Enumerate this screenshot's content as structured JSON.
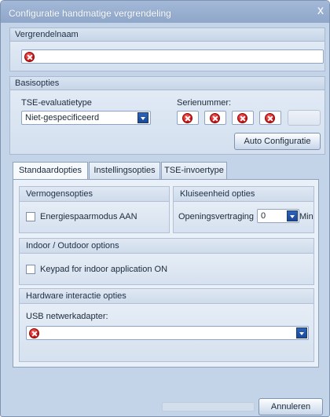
{
  "window": {
    "title": "Configuratie handmatige vergrendeling",
    "close_glyph": "x"
  },
  "lock_name": {
    "header": "Vergrendelnaam",
    "value": ""
  },
  "basic_options": {
    "header": "Basisopties",
    "tse_type_label": "TSE-evaluatietype",
    "tse_type_value": "Niet-gespecificeerd",
    "serial_label": "Serienummer:",
    "serial_fields": [
      "",
      "",
      "",
      ""
    ],
    "auto_config_label": "Auto Configuratie"
  },
  "tabs": [
    {
      "label": "Standaardopties",
      "active": true
    },
    {
      "label": "Instellingsopties",
      "active": false
    },
    {
      "label": "TSE-invoertype",
      "active": false
    }
  ],
  "standard_options": {
    "power_header": "Vermogensopties",
    "power_checkbox_label": "Energiespaarmodus AAN",
    "power_checked": false,
    "safe_header": "Kluiseenheid opties",
    "opening_delay_label": "Openingsvertraging",
    "opening_delay_value": "0",
    "opening_delay_unit": "Min",
    "indoor_header": "Indoor / Outdoor options",
    "keypad_label": "Keypad for indoor application ON",
    "keypad_checked": false,
    "hardware_header": "Hardware interactie opties",
    "usb_label": "USB netwerkadapter:",
    "usb_value": ""
  },
  "footer": {
    "cancel_label": "Annuleren"
  },
  "colors": {
    "accent": "#1a4996",
    "error": "#c30f0f",
    "title_bar": "#8ea6c9"
  },
  "icons": [
    "error-icon",
    "dropdown-arrow-icon",
    "close-icon",
    "checkbox-icon"
  ]
}
